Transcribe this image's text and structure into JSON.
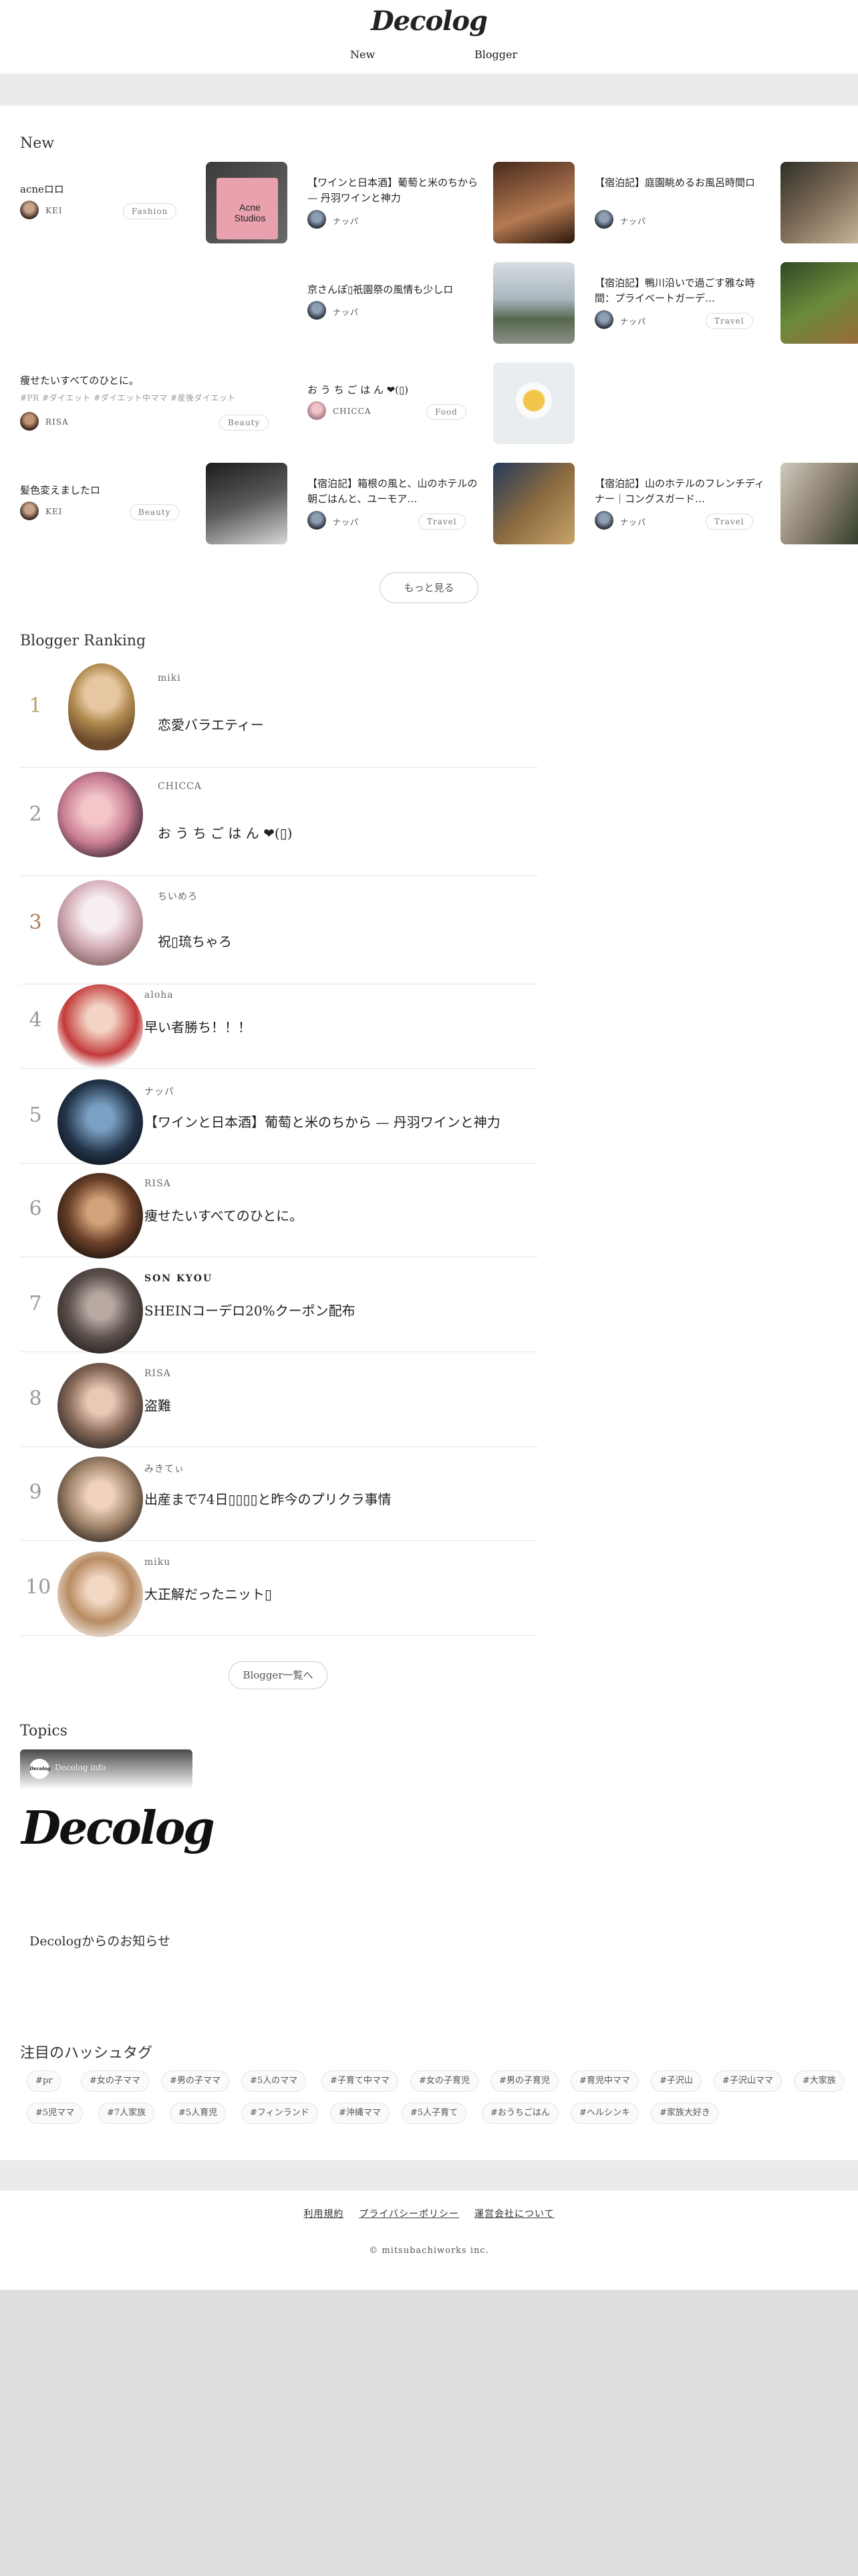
{
  "header": {
    "logo": "Decolog",
    "nav": [
      "New",
      "Blogger"
    ]
  },
  "new_section": {
    "title": "New",
    "items": [
      {
        "title": "acneロロ",
        "author": "KEI",
        "category": "Fashion"
      },
      {
        "title": "【ワインと日本酒】葡萄と米のちから — 丹羽ワインと神力",
        "author": "ナッパ",
        "category": ""
      },
      {
        "title": "【宿泊記】庭園眺めるお風呂時間ロ",
        "author": "ナッパ",
        "category": ""
      },
      {
        "title": "京さんぽ▯祇園祭の風情も少しロ",
        "author": "ナッパ",
        "category": ""
      },
      {
        "title": "【宿泊記】鴨川沿いで過ごす雅な時間：プライベートガーデ…",
        "author": "ナッパ",
        "category": "Travel"
      },
      {
        "title": "痩せたいすべてのひとに。",
        "hashtags": "#PR #ダイエット #ダイエット中ママ #産後ダイエット",
        "author": "RISA",
        "category": "Beauty"
      },
      {
        "title": "お う ち ご は ん ❤(▯)",
        "author": "CHICCA",
        "category": "Food"
      },
      {
        "title": "髪色変えましたロ",
        "author": "KEI",
        "category": "Beauty"
      },
      {
        "title": "【宿泊記】箱根の風と、山のホテルの朝ごはんと、ユーモア…",
        "author": "ナッパ",
        "category": "Travel"
      },
      {
        "title": "【宿泊記】山のホテルのフレンチディナー｜コングスガード…",
        "author": "ナッパ",
        "category": "Travel"
      }
    ],
    "more_button": "もっと見る"
  },
  "ranking": {
    "title": "Blogger Ranking",
    "items": [
      {
        "rank": "1",
        "name": "miki",
        "title": "恋愛バラエティー",
        "color": "#b3a46a"
      },
      {
        "rank": "2",
        "name": "CHICCA",
        "title": "お う ち ご は ん ❤(▯)",
        "color": "#9a9a9a"
      },
      {
        "rank": "3",
        "name": "ちいめろ",
        "title": "祝▯琉ちゃろ",
        "color": "#b07b58"
      },
      {
        "rank": "4",
        "name": "aloha",
        "title": "早い者勝ち！！！",
        "color": "#999999"
      },
      {
        "rank": "5",
        "name": "ナッパ",
        "title": "【ワインと日本酒】葡萄と米のちから — 丹羽ワインと神力",
        "color": "#999999"
      },
      {
        "rank": "6",
        "name": "RISA",
        "title": "痩せたいすべてのひとに。",
        "color": "#999999"
      },
      {
        "rank": "7",
        "name": "SON KYOU",
        "title": "SHEINコーデロ20%クーポン配布",
        "color": "#999999"
      },
      {
        "rank": "8",
        "name": "RISA",
        "title": "盗難",
        "color": "#999999"
      },
      {
        "rank": "9",
        "name": "みきてぃ",
        "title": "出産まで74日▯▯▯▯と昨今のプリクラ事情",
        "color": "#999999"
      },
      {
        "rank": "10",
        "name": "miku",
        "title": "大正解だったニット▯",
        "color": "#999999"
      }
    ],
    "list_button": "Blogger一覧へ"
  },
  "topics": {
    "title": "Topics",
    "badge_author": "Decolog info",
    "badge_logo": "Decolog",
    "big_logo": "Decolog",
    "caption": "Decologからのお知らせ"
  },
  "hashtags": {
    "title": "注目のハッシュタグ",
    "row1": [
      "#pr",
      "#女の子ママ",
      "#男の子ママ",
      "#5人のママ",
      "#子育て中ママ",
      "#女の子育児",
      "#男の子育児",
      "#育児中ママ",
      "#子沢山",
      "#子沢山ママ",
      "#大家族"
    ],
    "row2": [
      "#5児ママ",
      "#7人家族",
      "#5人育児",
      "#フィンランド",
      "#沖縄ママ",
      "#5人子育て",
      "#おうちごはん",
      "#ヘルシンキ",
      "#家族大好き"
    ]
  },
  "footer": {
    "links": [
      "利用規約",
      "プライバシーポリシー",
      "運営会社について"
    ],
    "copyright": "© mitsubachiworks inc."
  }
}
